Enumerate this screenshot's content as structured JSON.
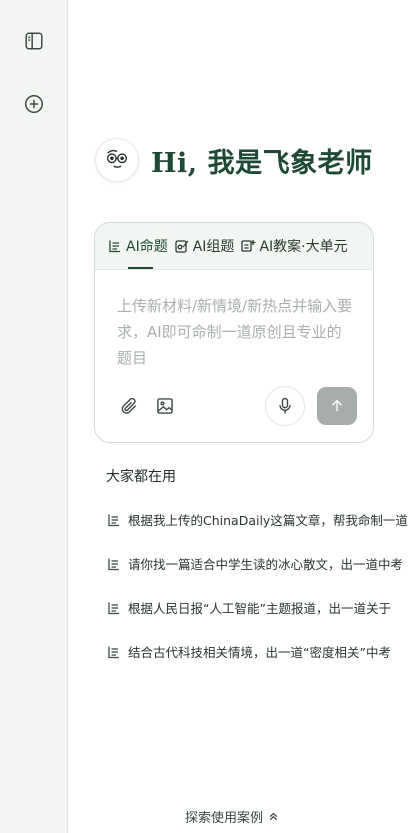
{
  "sidebar": {
    "icons": [
      "sidebar-toggle-icon",
      "new-chat-icon"
    ]
  },
  "hero": {
    "greeting": "Hi, 我是飞象老师"
  },
  "composer": {
    "tabs": [
      {
        "label": "AI命题",
        "active": true
      },
      {
        "label": "AI组题",
        "active": false
      },
      {
        "label": "AI教案·大单元",
        "active": false
      }
    ],
    "placeholder": "上传新材料/新情境/新热点并输入要求，AI即可命制一道原创且专业的题目"
  },
  "suggestions": {
    "title": "大家都在用",
    "items": [
      "根据我上传的ChinaDaily这篇文章，帮我命制一道",
      "请你找一篇适合中学生读的冰心散文，出一道中考",
      "根据人民日报“人工智能”主题报道，出一道关于",
      "结合古代科技相关情境，出一道“密度相关”中考"
    ]
  },
  "footer": {
    "explore_label": "探索使用案例"
  },
  "colors": {
    "accent": "#1e4a35",
    "sidebar_bg": "#f2f5f2",
    "send_disabled": "#a7aeaa"
  }
}
